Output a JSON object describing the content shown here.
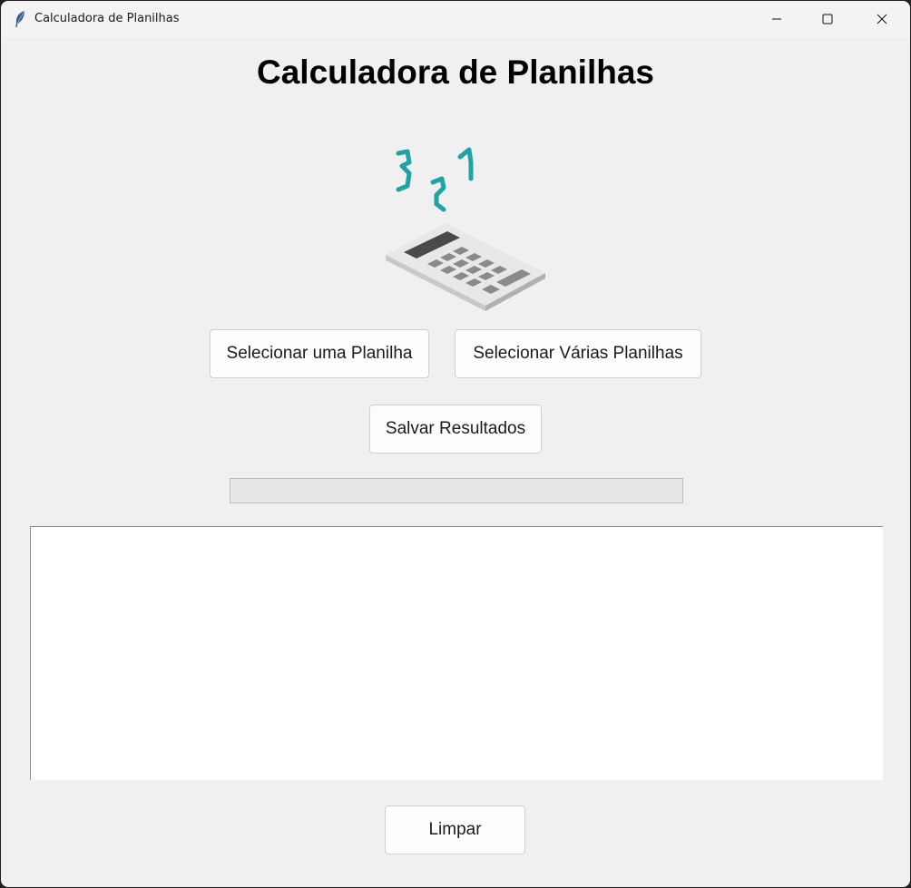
{
  "window": {
    "title": "Calculadora de Planilhas",
    "icon": "feather-icon"
  },
  "header": {
    "title": "Calculadora de Planilhas",
    "illustration": "calculator-icon"
  },
  "buttons": {
    "select_one": "Selecionar uma Planilha",
    "select_many": "Selecionar Várias Planilhas",
    "save": "Salvar Resultados",
    "clear": "Limpar"
  },
  "progress": {
    "value": 0
  },
  "output": {
    "text": ""
  },
  "colors": {
    "accent": "#1fa3a3"
  }
}
